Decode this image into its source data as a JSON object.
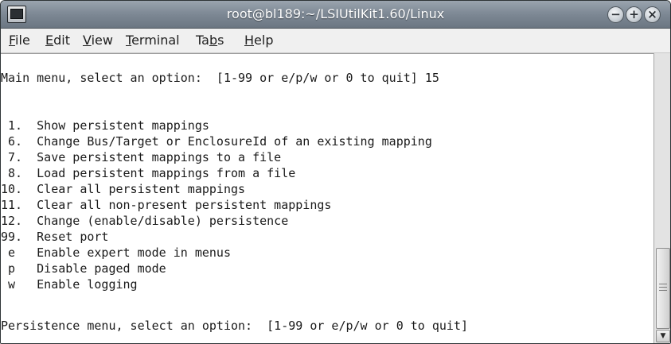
{
  "window": {
    "title": "root@bl189:~/LSIUtilKit1.60/Linux",
    "minimize_glyph": "−",
    "maximize_glyph": "+",
    "close_glyph": "×"
  },
  "menubar": {
    "items": [
      {
        "pre": "",
        "accel": "F",
        "post": "ile"
      },
      {
        "pre": "",
        "accel": "E",
        "post": "dit"
      },
      {
        "pre": "",
        "accel": "V",
        "post": "iew"
      },
      {
        "pre": "",
        "accel": "T",
        "post": "erminal"
      },
      {
        "pre": "Ta",
        "accel": "b",
        "post": "s"
      },
      {
        "pre": "",
        "accel": "H",
        "post": "elp"
      }
    ]
  },
  "terminal": {
    "lines": [
      "Main menu, select an option:  [1-99 or e/p/w or 0 to quit] 15",
      "",
      " 1.  Show persistent mappings",
      " 6.  Change Bus/Target or EnclosureId of an existing mapping",
      " 7.  Save persistent mappings to a file",
      " 8.  Load persistent mappings from a file",
      "10.  Clear all persistent mappings",
      "11.  Clear all non-present persistent mappings",
      "12.  Change (enable/disable) persistence",
      "99.  Reset port",
      " e   Enable expert mode in menus",
      " p   Disable paged mode",
      " w   Enable logging",
      "",
      "Persistence menu, select an option:  [1-99 or e/p/w or 0 to quit]"
    ]
  },
  "scrollbar": {
    "down_arrow": "▼"
  },
  "icons": {
    "app": "terminal-icon",
    "minimize": "minimize-icon",
    "maximize": "maximize-icon",
    "close": "close-icon",
    "scroll_down": "arrow-down-icon"
  }
}
